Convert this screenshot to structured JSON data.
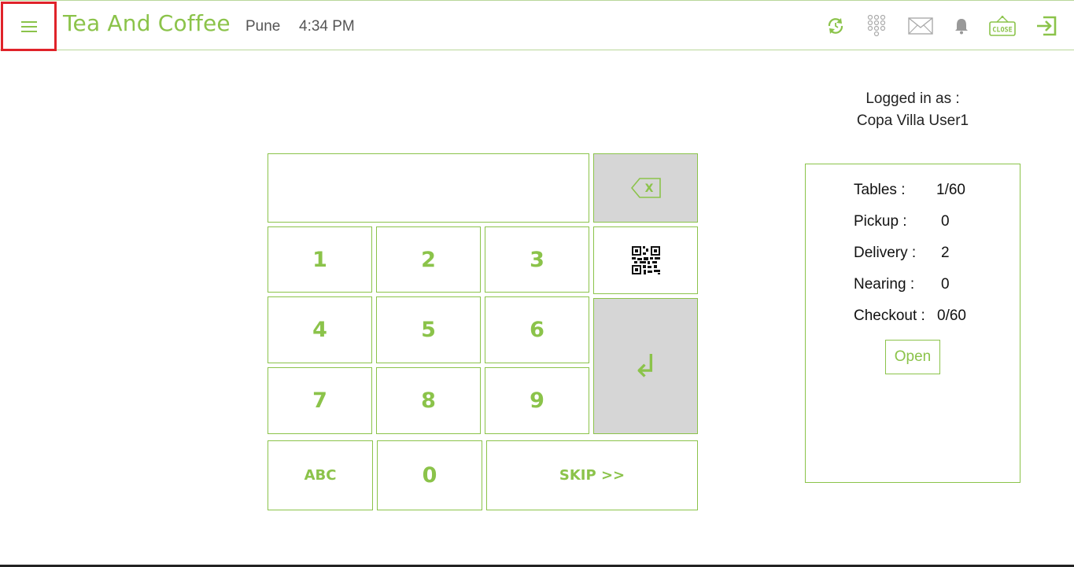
{
  "header": {
    "menu_icon": "hamburger-menu-icon",
    "title": "Tea And Coffee",
    "city": "Pune",
    "time": "4:34 PM",
    "close_sign_text": "CLOSE",
    "icons": [
      "refresh-icon",
      "dialpad-icon",
      "mail-icon",
      "bell-icon",
      "close-sign-icon",
      "logout-icon"
    ]
  },
  "user": {
    "logged_label": "Logged in as :",
    "name": "Copa Villa User1"
  },
  "keypad": {
    "k1": "1",
    "k2": "2",
    "k3": "3",
    "k4": "4",
    "k5": "5",
    "k6": "6",
    "k7": "7",
    "k8": "8",
    "k9": "9",
    "k0": "0",
    "abc": "ABC",
    "skip": "SKIP >>",
    "backspace_glyph": "X",
    "enter_glyph": "↲"
  },
  "stats": {
    "tables_label": "Tables :",
    "tables_value": "1/60",
    "pickup_label": "Pickup :",
    "pickup_value": "0",
    "delivery_label": "Delivery :",
    "delivery_value": "2",
    "nearing_label": "Nearing :",
    "nearing_value": "0",
    "checkout_label": "Checkout :",
    "checkout_value": "0/60",
    "open_button": "Open"
  },
  "colors": {
    "accent": "#8bc34a",
    "key_grey": "#d6d6d6",
    "highlight": "#e0232a"
  }
}
